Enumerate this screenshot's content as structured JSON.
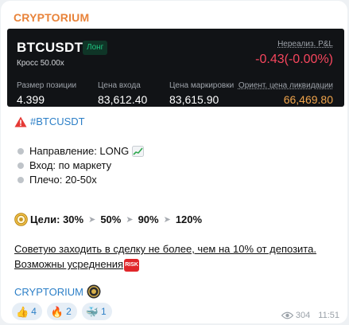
{
  "channel": {
    "name": "CRYPTORIUM"
  },
  "card": {
    "pair": "BTCUSDT",
    "side_badge": "Лонг",
    "margin_mode": "Кросс 50.00x",
    "pnl_label": "Нереализ. P&L",
    "pnl_value": "-0.43(-0.00%)",
    "position_size_label": "Размер позиции",
    "position_size_value": "4.399",
    "entry_price_label": "Цена входа",
    "entry_price_value": "83,612.40",
    "mark_price_label": "Цена маркировки",
    "mark_price_value": "83,615.90",
    "liq_price_label": "Ориент. цена ликвидации",
    "liq_price_value": "66,469.80"
  },
  "hashtag": "#BTCUSDT",
  "details": [
    "Направление: LONG",
    "Вход: по маркету",
    "Плечо: 20-50x"
  ],
  "targets": {
    "label": "Цели: 30%",
    "values": [
      "50%",
      "90%",
      "120%"
    ]
  },
  "advice_text": "Советую заходить в сделку не более, чем на 10% от депозита. Возможны усреднения",
  "risk_badge": "RISK",
  "signature": "CRYPTORIUM",
  "reactions": [
    {
      "emoji": "👍",
      "count": "4"
    },
    {
      "emoji": "🔥",
      "count": "2"
    },
    {
      "emoji": "🐳",
      "count": "1"
    }
  ],
  "views": "304",
  "time": "11:51",
  "colors": {
    "channel_name": "#e8833a",
    "link": "#2c7fc7",
    "pnl_negative": "#f6465d",
    "long_green": "#1fc27f",
    "liq_orange": "#f0a44b",
    "card_bg": "#111316"
  },
  "icons": [
    "warning-icon",
    "chart-increasing-icon",
    "target-icon",
    "chevron-right-icon",
    "risk-icon",
    "coin-icon",
    "eye-icon"
  ]
}
